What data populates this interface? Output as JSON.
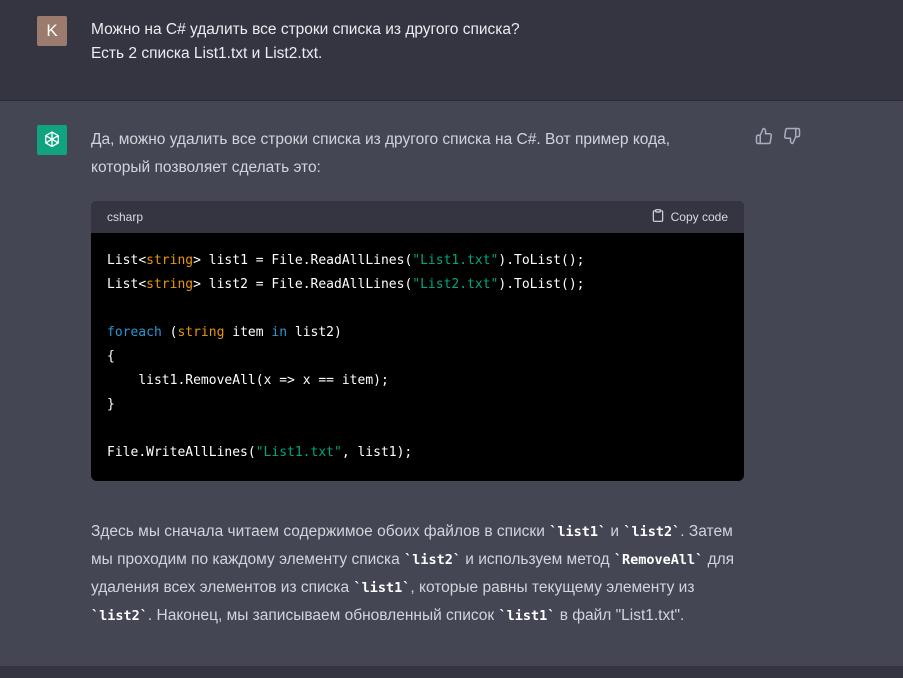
{
  "user_message": {
    "avatar_letter": "K",
    "lines": [
      "Можно на C# удалить все строки списка из другого списка?",
      "Есть 2 списка List1.txt и List2.txt."
    ]
  },
  "assistant_message": {
    "intro_lines": [
      "Да, можно удалить все строки списка из другого списка на C#. Вот пример кода,",
      "который позволяет сделать это:"
    ],
    "code_block": {
      "language": "csharp",
      "copy_label": "Copy code",
      "lines": [
        "List<string> list1 = File.ReadAllLines(\"List1.txt\").ToList();",
        "List<string> list2 = File.ReadAllLines(\"List2.txt\").ToList();",
        "",
        "foreach (string item in list2)",
        "{",
        "    list1.RemoveAll(x => x == item);",
        "}",
        "",
        "File.WriteAllLines(\"List1.txt\", list1);"
      ]
    },
    "explanation": {
      "l1_a": "Здесь мы сначала читаем содержимое обоих файлов в списки ",
      "l1_code1": "`list1`",
      "l1_b": " и ",
      "l1_code2": "`list2`",
      "l1_c": ". Затем",
      "l2_a": "мы проходим по каждому элементу списка ",
      "l2_code1": "`list2`",
      "l2_b": " и используем метод ",
      "l2_code2": "`RemoveAll`",
      "l2_c": " для",
      "l3_a": "удаления всех элементов из списка ",
      "l3_code1": "`list1`",
      "l3_b": ", которые равны текущему элементу из",
      "l4_code1": "`list2`",
      "l4_a": ". Наконец, мы записываем обновленный список ",
      "l4_code2": "`list1`",
      "l4_b": " в файл \"List1.txt\"."
    }
  },
  "icons": {
    "bot_avatar": "openai-logo-icon",
    "thumbs_up": "thumbs-up-icon",
    "thumbs_down": "thumbs-down-icon",
    "copy": "clipboard-icon"
  },
  "colors": {
    "user_bg": "#343541",
    "assistant_bg": "#444654",
    "bot_avatar_bg": "#10a37f",
    "user_avatar_bg": "#9b7b6e",
    "code_bg": "#000000",
    "code_header_bg": "#343541"
  }
}
